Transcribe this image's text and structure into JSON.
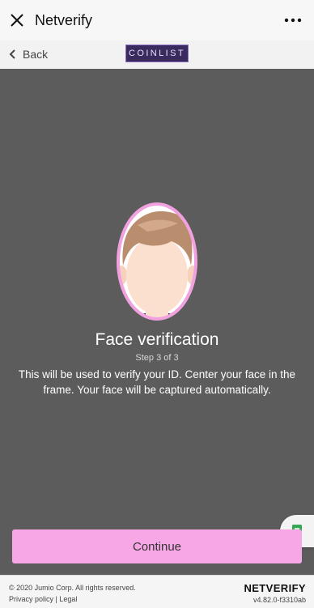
{
  "appbar": {
    "title": "Netverify"
  },
  "subbar": {
    "back_label": "Back",
    "brand_label": "COINLIST"
  },
  "main": {
    "heading": "Face verification",
    "step": "Step 3 of 3",
    "description": "This will be used to verify your ID. Center your face in the frame. Your face will be captured automatically.",
    "continue_label": "Continue"
  },
  "footer": {
    "copyright": "© 2020 Jumio Corp. All rights reserved.",
    "privacy_label": "Privacy policy",
    "separator": "|",
    "legal_label": "Legal",
    "brand": "NETVERIFY",
    "version": "v4.82.0-f3310ab"
  },
  "icons": {
    "close": "close-icon",
    "menu": "more-vert-icon",
    "back": "chevron-left-icon",
    "fab": "document-icon"
  },
  "colors": {
    "accent": "#f7a7e6",
    "background": "#5c5c5c",
    "oval": "#f1a0e0"
  }
}
